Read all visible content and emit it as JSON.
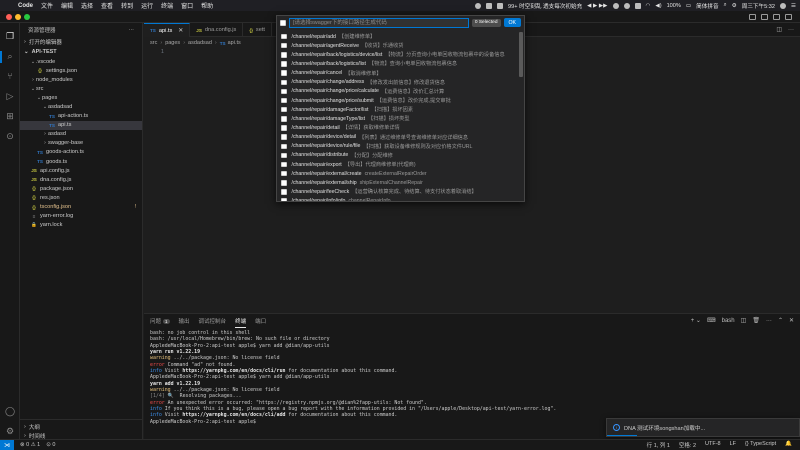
{
  "menubar": {
    "app_name": "Code",
    "items": [
      "文件",
      "编辑",
      "选择",
      "查看",
      "转到",
      "运行",
      "终端",
      "窗口",
      "帮助"
    ],
    "status_text": "99+  时空刻乱 透支每次初始充",
    "battery": "100%",
    "input_method": "简体拼音",
    "clock": "周三下午5:32"
  },
  "sidebar": {
    "header": "资源管理器",
    "open_editors": "打开的编辑器",
    "workspace": "API-TEST",
    "tree": [
      {
        "label": ".vscode",
        "depth": 1,
        "kind": "folder",
        "open": true
      },
      {
        "label": "settings.json",
        "depth": 2,
        "kind": "json"
      },
      {
        "label": "node_modules",
        "depth": 1,
        "kind": "folder",
        "open": false
      },
      {
        "label": "src",
        "depth": 1,
        "kind": "folder",
        "open": true
      },
      {
        "label": "pages",
        "depth": 2,
        "kind": "folder",
        "open": true
      },
      {
        "label": "asdadsad",
        "depth": 3,
        "kind": "folder",
        "open": true
      },
      {
        "label": "api-action.ts",
        "depth": 4,
        "kind": "ts"
      },
      {
        "label": "api.ts",
        "depth": 4,
        "kind": "ts",
        "selected": true
      },
      {
        "label": "asdasd",
        "depth": 3,
        "kind": "folder",
        "open": false
      },
      {
        "label": "swagger-base",
        "depth": 3,
        "kind": "folder",
        "open": false
      },
      {
        "label": "goods-action.ts",
        "depth": 2,
        "kind": "ts"
      },
      {
        "label": "goods.ts",
        "depth": 2,
        "kind": "ts"
      },
      {
        "label": "api.config.js",
        "depth": 1,
        "kind": "js"
      },
      {
        "label": "dna.config.js",
        "depth": 1,
        "kind": "js"
      },
      {
        "label": "package.json",
        "depth": 1,
        "kind": "json"
      },
      {
        "label": "res.json",
        "depth": 1,
        "kind": "json"
      },
      {
        "label": "tsconfig.json",
        "depth": 1,
        "kind": "json",
        "modified": true,
        "badge": "!"
      },
      {
        "label": "yarn-error.log",
        "depth": 1,
        "kind": "log"
      },
      {
        "label": "yarn.lock",
        "depth": 1,
        "kind": "lock"
      }
    ],
    "outline": "大纲",
    "timeline": "时间线"
  },
  "editor": {
    "tabs": [
      {
        "label": "api.ts",
        "kind": "ts",
        "active": true
      },
      {
        "label": "dna.config.js",
        "kind": "js",
        "active": false
      },
      {
        "label": "sett",
        "kind": "json",
        "active": false
      }
    ],
    "breadcrumb": [
      "src",
      "pages",
      "asdadsad",
      "api.ts"
    ],
    "line_number": "1"
  },
  "quickpick": {
    "placeholder": "[请选择swagger下的接口路径生成代码",
    "selected_count": "0 Selected",
    "ok_label": "OK",
    "items": [
      {
        "path": "/channel/repair/add",
        "desc": "【创建维修单】"
      },
      {
        "path": "/channel/repair/agentReceive",
        "desc": "【收货】乐通收货"
      },
      {
        "path": "/channel/repair/back/logistics/device/list",
        "desc": "【物流】分页查询小电单回收物流包裹中的设备信息"
      },
      {
        "path": "/channel/repair/back/logistics/list",
        "desc": "【物流】查询小电单回收物流包裹信息"
      },
      {
        "path": "/channel/repair/cancel",
        "desc": "【取消维修单】"
      },
      {
        "path": "/channel/repair/change/address",
        "desc": "【修改发出前信息】修改退货信息"
      },
      {
        "path": "/channel/repair/change/price/calculate",
        "desc": "【运费信息】改价汇总计算"
      },
      {
        "path": "/channel/repair/change/price/submit",
        "desc": "【运费信息】改价完成,提交审批"
      },
      {
        "path": "/channel/repair/damageFactor/list",
        "desc": "【扫描】损坏因素"
      },
      {
        "path": "/channel/repair/damageType/list",
        "desc": "【扫描】损坏类型"
      },
      {
        "path": "/channel/repair/detail",
        "desc": "【详情】获取维修单详情"
      },
      {
        "path": "/channel/repair/device/detail",
        "desc": "【列表】通过维修单号查询维修单对应详细信息"
      },
      {
        "path": "/channel/repair/device/rule/file",
        "desc": "【扫描】获取设备维修规则及对应价格文件URL"
      },
      {
        "path": "/channel/repair/distribute",
        "desc": "【分配】分配维修"
      },
      {
        "path": "/channel/repair/export",
        "desc": "【导出】代理商维修单(代理商)"
      },
      {
        "path": "/channel/repair/external/create",
        "desc": "createExternalRepairOrder"
      },
      {
        "path": "/channel/repair/external/ship",
        "desc": "shipExternalChannelRepair"
      },
      {
        "path": "/channel/repair/feeCheck",
        "desc": "【运营确认核算完成、待结算、待支付状态着取消结】"
      },
      {
        "path": "/channel/repair/info/info",
        "desc": "channelRepairInfo"
      }
    ]
  },
  "panel": {
    "tabs": [
      {
        "label": "问题",
        "badge": "1"
      },
      {
        "label": "输出"
      },
      {
        "label": "调试控制台"
      },
      {
        "label": "终端",
        "active": true
      },
      {
        "label": "端口"
      }
    ],
    "shell": "bash"
  },
  "terminal": {
    "lines": [
      [
        {
          "t": "bash: no job control in this shell"
        }
      ],
      [
        {
          "t": "bash: /usr/local/Homebrew/bin/brew: No such file or directory"
        }
      ],
      [
        {
          "t": "AppledeMacBook-Pro-2:api-test apple$ yarn add @dian/app-utils"
        }
      ],
      [
        {
          "t": "yarn run v1.22.19",
          "c": "t-bold"
        }
      ],
      [
        {
          "t": "warning",
          "c": "t-warn"
        },
        {
          "t": " ../../package.json: No license field"
        }
      ],
      [
        {
          "t": "error",
          "c": "t-err"
        },
        {
          "t": " Command \"ad\" not found."
        }
      ],
      [
        {
          "t": "info",
          "c": "t-info"
        },
        {
          "t": " Visit "
        },
        {
          "t": "https://yarnpkg.com/en/docs/cli/run",
          "c": "t-bold"
        },
        {
          "t": " for documentation about this command."
        }
      ],
      [
        {
          "t": "AppledeMacBook-Pro-2:api-test apple$ yarn add @dian/app-utils"
        }
      ],
      [
        {
          "t": "yarn add v1.22.19",
          "c": "t-bold"
        }
      ],
      [
        {
          "t": "warning",
          "c": "t-warn"
        },
        {
          "t": " ../../package.json: No license field"
        }
      ],
      [
        {
          "t": "[1/4]",
          "c": "t-gray"
        },
        {
          "t": " 🔍  Resolving packages..."
        }
      ],
      [
        {
          "t": "error",
          "c": "t-err"
        },
        {
          "t": " An unexpected error occurred: \"https://registry.npmjs.org/@dian%2fapp-utils: Not found\"."
        }
      ],
      [
        {
          "t": "info",
          "c": "t-info"
        },
        {
          "t": " If you think this is a bug, please open a bug report with the information provided in \"/Users/apple/Desktop/api-test/yarn-error.log\"."
        }
      ],
      [
        {
          "t": "info",
          "c": "t-info"
        },
        {
          "t": " Visit "
        },
        {
          "t": "https://yarnpkg.com/en/docs/cli/add",
          "c": "t-bold"
        },
        {
          "t": " for documentation about this command."
        }
      ],
      [
        {
          "t": "AppledeMacBook-Pro-2:api-test apple$ "
        }
      ]
    ]
  },
  "notification": {
    "text": "DNA 测试环境songshan加载中..."
  },
  "statusbar": {
    "problems": "⊗ 0 ⚠ 1",
    "ports": "⊙ 0",
    "cursor": "行 1, 列 1",
    "spaces": "空格: 2",
    "encoding": "UTF-8",
    "eol": "LF",
    "language": "{} TypeScript"
  },
  "colors": {
    "accent": "#0078d4",
    "background": "#1e1e1e",
    "sidebar": "#181818",
    "quickpick": "#252526",
    "error": "#f14c4c",
    "warning": "#e5c07b"
  }
}
